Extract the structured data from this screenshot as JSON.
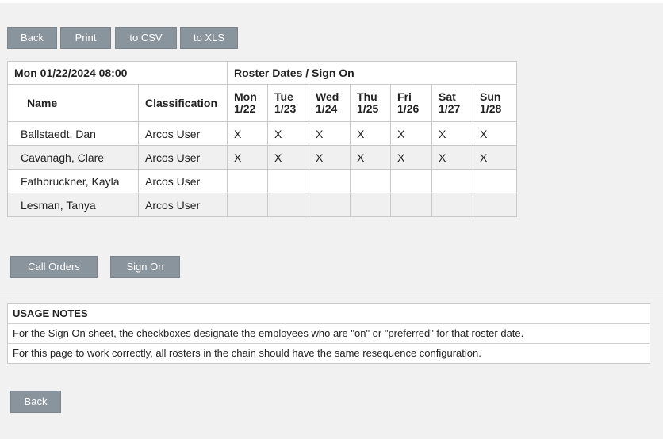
{
  "toolbar": {
    "back_label": "Back",
    "print_label": "Print",
    "csv_label": "to CSV",
    "xls_label": "to XLS"
  },
  "roster": {
    "datetime": "Mon 01/22/2024 08:00",
    "header_title": "Roster Dates / Sign On",
    "col_name": "Name",
    "col_class": "Classification",
    "days": [
      {
        "label": "Mon 1/22"
      },
      {
        "label": "Tue 1/23"
      },
      {
        "label": "Wed 1/24"
      },
      {
        "label": "Thu 1/25"
      },
      {
        "label": "Fri 1/26"
      },
      {
        "label": "Sat 1/27"
      },
      {
        "label": "Sun 1/28"
      }
    ],
    "rows": [
      {
        "name": "Ballstaedt, Dan",
        "classification": "Arcos User",
        "marks": [
          "X",
          "X",
          "X",
          "X",
          "X",
          "X",
          "X"
        ]
      },
      {
        "name": "Cavanagh, Clare",
        "classification": "Arcos User",
        "marks": [
          "X",
          "X",
          "X",
          "X",
          "X",
          "X",
          "X"
        ]
      },
      {
        "name": "Fathbruckner, Kayla",
        "classification": "Arcos User",
        "marks": [
          "",
          "",
          "",
          "",
          "",
          "",
          ""
        ]
      },
      {
        "name": "Lesman, Tanya",
        "classification": "Arcos User",
        "marks": [
          "",
          "",
          "",
          "",
          "",
          "",
          ""
        ]
      }
    ]
  },
  "actions": {
    "call_orders_label": "Call Orders",
    "sign_on_label": "Sign On"
  },
  "usage": {
    "title": "USAGE NOTES",
    "note1": "For the Sign On sheet, the checkboxes designate the employees who are \"on\" or \"preferred\" for that roster date.",
    "note2": "For this page to work correctly, all rosters in the chain should have the same resequence configuration."
  },
  "footer": {
    "back_label": "Back"
  },
  "colors": {
    "button_bg": "#8a949c",
    "page_bg": "#f1f1f1",
    "row_alt_bg": "#f0f0f0"
  }
}
